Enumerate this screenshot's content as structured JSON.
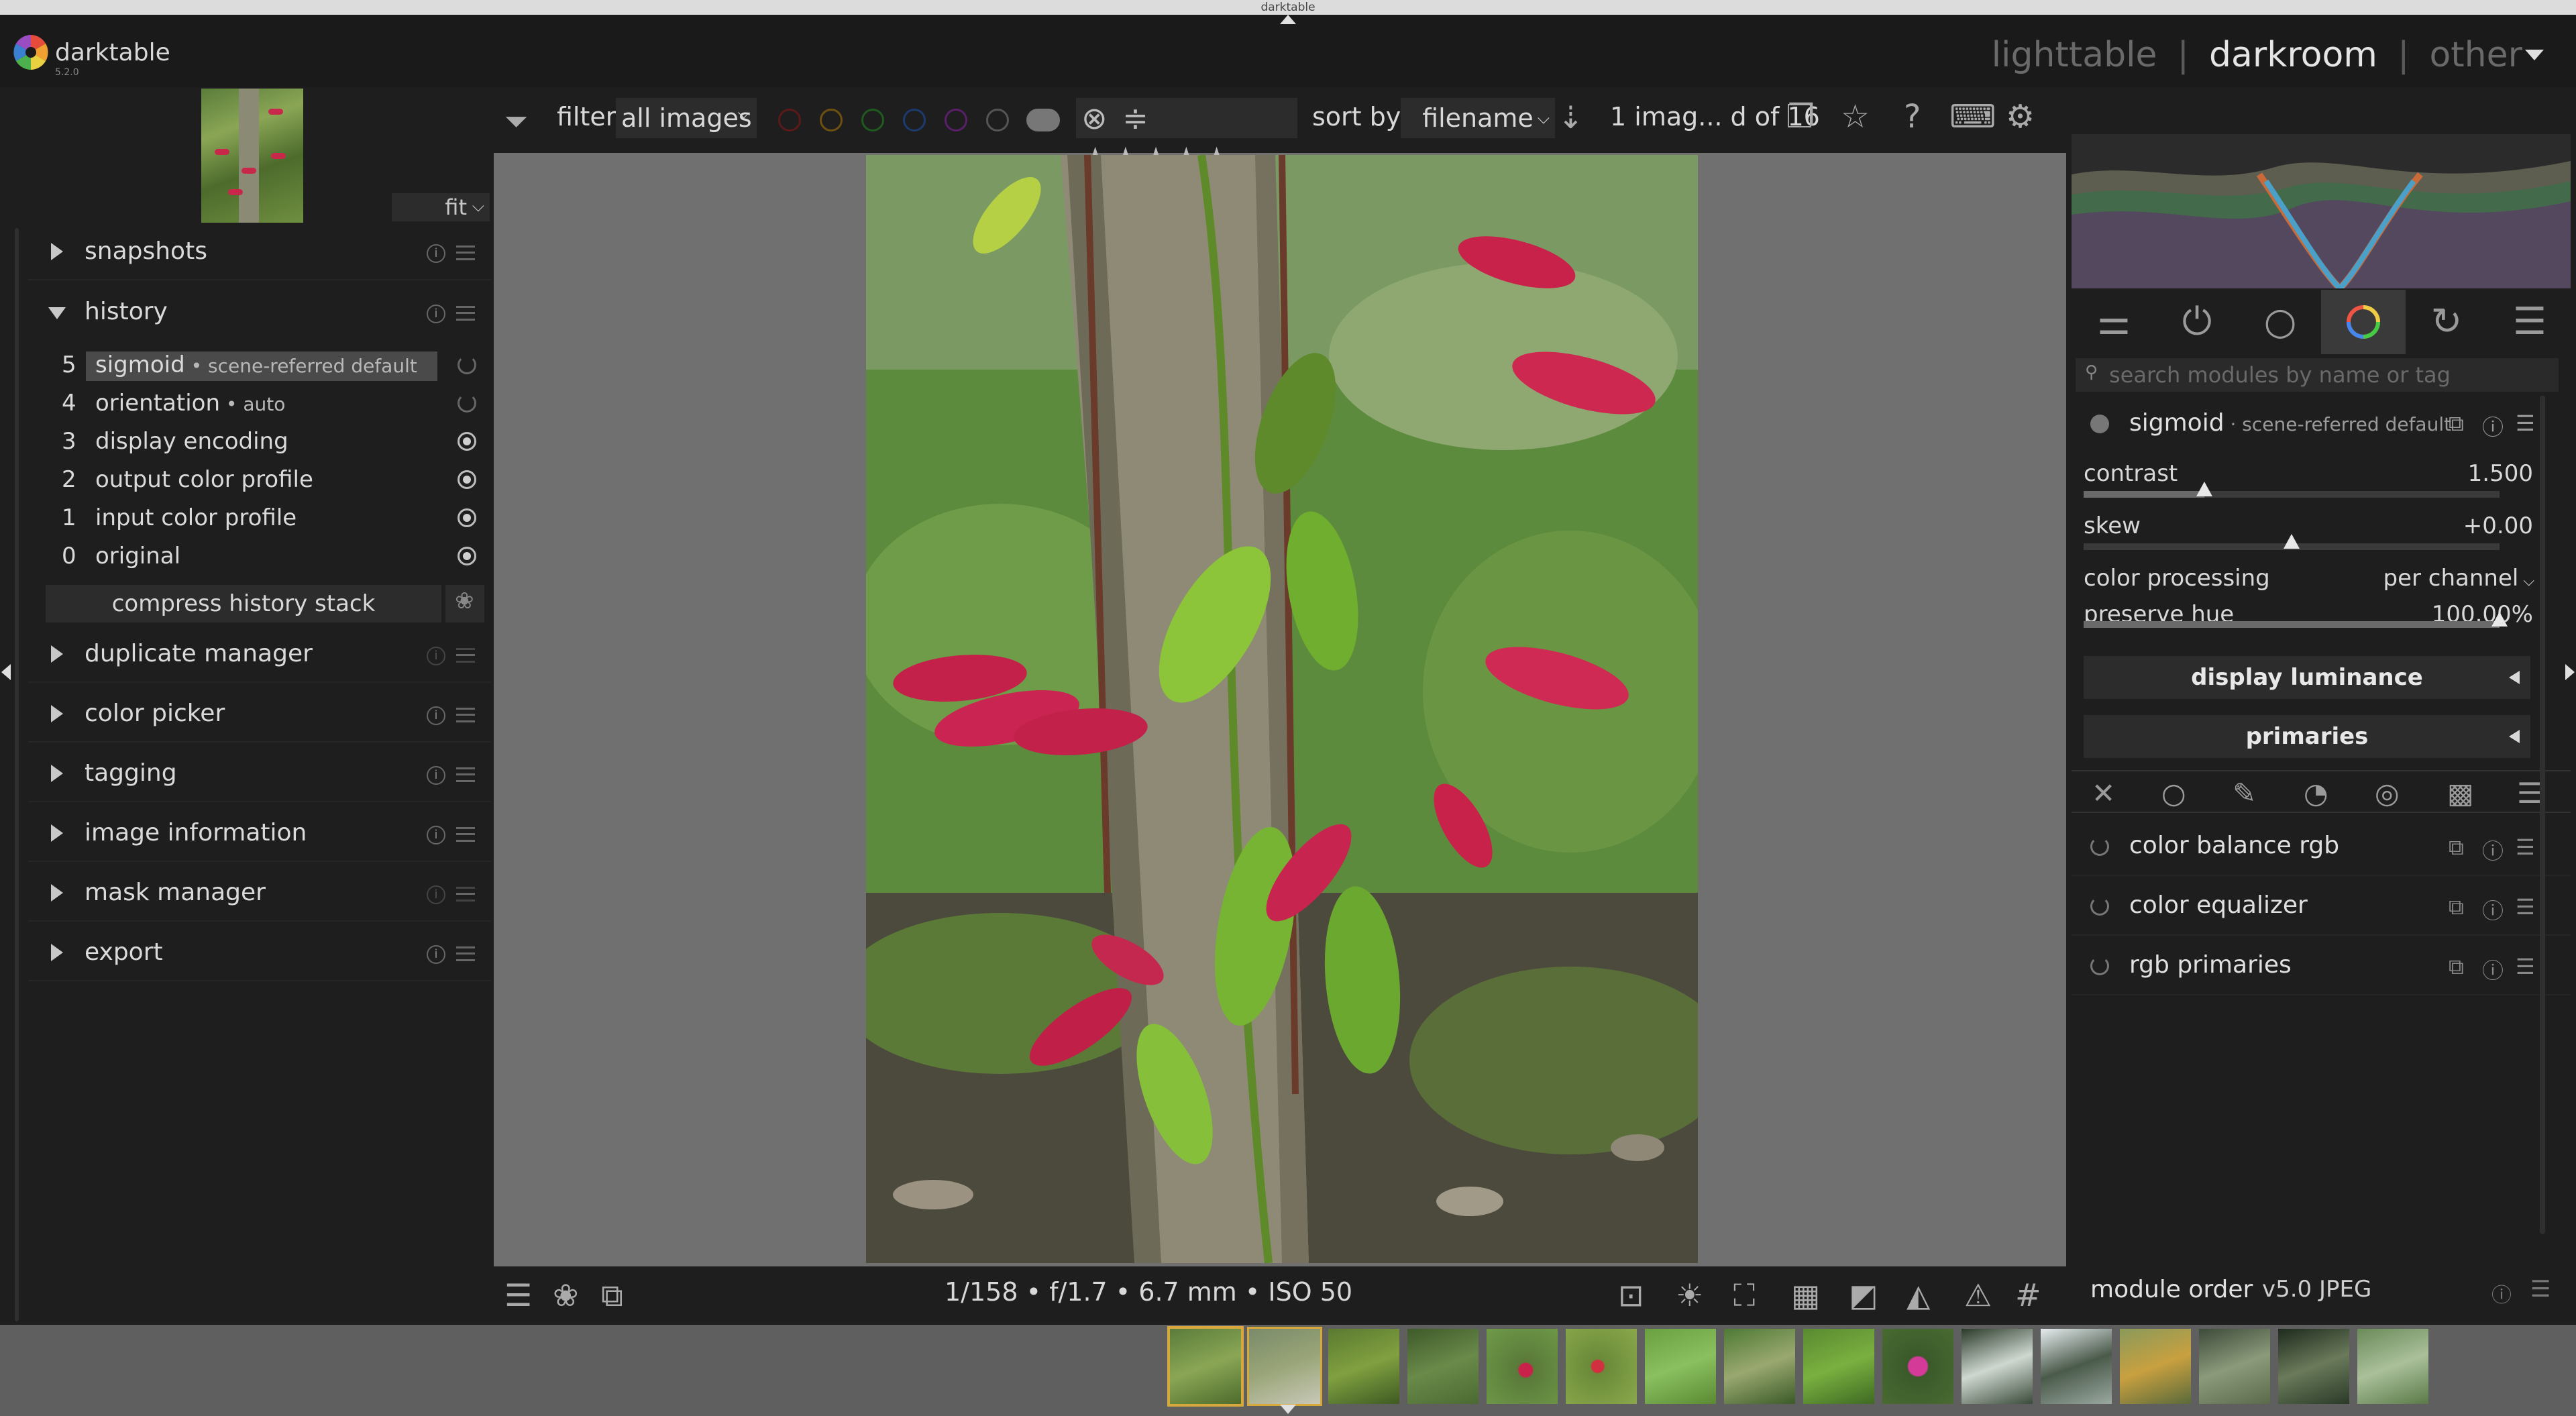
{
  "window": {
    "title": "darktable"
  },
  "app": {
    "name": "darktable",
    "version": "5.2.0"
  },
  "views": {
    "lighttable": "lighttable",
    "darkroom": "darkroom",
    "other": "other",
    "separator": "|"
  },
  "left_panel": {
    "zoom": "fit",
    "modules": {
      "snapshots": "snapshots",
      "history": "history",
      "duplicate_manager": "duplicate manager",
      "color_picker": "color picker",
      "tagging": "tagging",
      "image_information": "image information",
      "mask_manager": "mask manager",
      "export": "export"
    },
    "history_items": [
      {
        "num": "5",
        "name": "sigmoid",
        "suffix": " • scene-referred default"
      },
      {
        "num": "4",
        "name": "orientation",
        "suffix": " • auto"
      },
      {
        "num": "3",
        "name": "display encoding",
        "suffix": ""
      },
      {
        "num": "2",
        "name": "output color profile",
        "suffix": ""
      },
      {
        "num": "1",
        "name": "input color profile",
        "suffix": ""
      },
      {
        "num": "0",
        "name": "original",
        "suffix": ""
      }
    ],
    "compress_label": "compress history stack"
  },
  "toolbar": {
    "filter_label": "filter",
    "filter_value": "all images",
    "sort_label": "sort by",
    "sort_value": "filename",
    "count": "1 imag... d of 16",
    "color_labels": [
      "#8b1a1a",
      "#a36b14",
      "#2f7a2f",
      "#2a4d8f",
      "#7a2f8a"
    ]
  },
  "image": {
    "exif": "1/158 • f/1.7 • 6.7 mm • ISO 50"
  },
  "right_panel": {
    "search_placeholder": "search modules by name or tag",
    "active_module": {
      "name": "sigmoid",
      "preset": " · scene-referred default"
    },
    "sliders": {
      "contrast": {
        "label": "contrast",
        "value": "1.500",
        "fraction": 0.29
      },
      "skew": {
        "label": "skew",
        "value": "+0.00",
        "fraction": 0.5
      },
      "preserve_hue": {
        "label": "preserve hue",
        "value": "100.00%",
        "fraction": 1.0
      }
    },
    "color_processing": {
      "label": "color processing",
      "value": "per channel"
    },
    "sections": {
      "display_luminance": "display luminance",
      "primaries": "primaries"
    },
    "other_modules": [
      "color balance rgb",
      "color equalizer",
      "rgb primaries"
    ],
    "module_order_label": "module order",
    "module_order_value": "v5.0 JPEG"
  }
}
